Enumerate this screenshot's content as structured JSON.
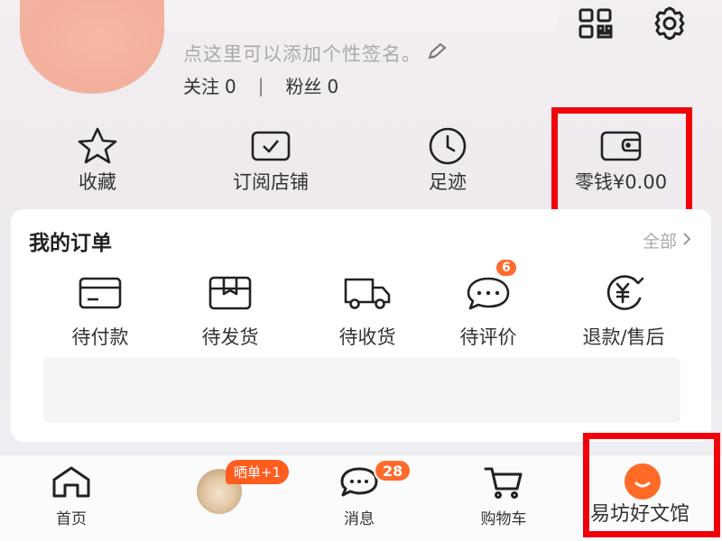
{
  "profile": {
    "signature": "点这里可以添加个性签名。",
    "following_label": "关注",
    "following_count": "0",
    "followers_label": "粉丝",
    "followers_count": "0",
    "divider": "|"
  },
  "header_icons": [
    "qr-code-icon",
    "gear-icon"
  ],
  "shortcuts": [
    {
      "label": "收藏",
      "icon": "star-icon"
    },
    {
      "label": "订阅店铺",
      "icon": "subscribe-store-icon"
    },
    {
      "label": "足迹",
      "icon": "clock-icon"
    },
    {
      "label": "零钱¥0.00",
      "icon": "wallet-icon"
    }
  ],
  "orders": {
    "title": "我的订单",
    "view_all": "全部",
    "items": [
      {
        "label": "待付款",
        "icon": "card-icon",
        "badge": null
      },
      {
        "label": "待发货",
        "icon": "package-icon",
        "badge": null
      },
      {
        "label": "待收货",
        "icon": "truck-icon",
        "badge": null
      },
      {
        "label": "待评价",
        "icon": "chat-icon",
        "badge": "6"
      },
      {
        "label": "退款/售后",
        "icon": "refund-yen-icon",
        "badge": null
      }
    ]
  },
  "tabbar": {
    "home": "首页",
    "promo_badge": "晒单+1",
    "messages": "消息",
    "messages_badge": "28",
    "cart": "购物车",
    "me_watermark": "易坊好文馆"
  },
  "colors": {
    "accent": "#ff6b2c",
    "highlight_box": "#f1000b",
    "muted_text": "#a9a9ae"
  }
}
